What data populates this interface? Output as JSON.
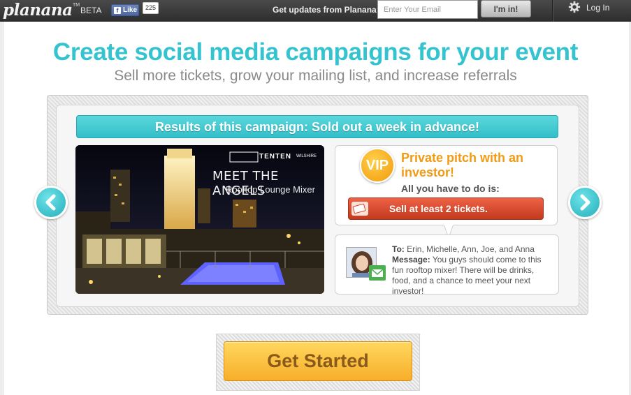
{
  "topbar": {
    "logo": "planana",
    "logo_tm": "TM",
    "beta": "BETA",
    "fb_like_label": "Like",
    "fb_like_count": "225",
    "updates_label": "Get updates from Planana:",
    "email_placeholder": "Enter Your Email",
    "submit_label": "I'm in!",
    "login_label": "Log In"
  },
  "hero": {
    "headline": "Create social media campaigns for your event",
    "subheadline": "Sell more tickets, grow your mailing list, and increase referrals"
  },
  "showcase": {
    "banner": "Results of this campaign: Sold out a week in advance!",
    "event_image": {
      "title": "MEET THE ANGELS",
      "subtitle": "Rooftop Lounge Mixer",
      "logo_text": "TENTEN",
      "logo_sub": "WILSHIRE"
    },
    "vip": {
      "badge": "VIP",
      "title": "Private pitch with an investor!",
      "subtitle": "All you have to do is:",
      "button_label": "Sell at least 2 tickets."
    },
    "message": {
      "to_label": "To:",
      "to_value": "Erin, Michelle, Ann, Joe, and Anna",
      "message_label": "Message:",
      "message_value": "You guys should come to this fun rooftop mixer! There will be drinks, food, and a chance to meet your next investor!"
    }
  },
  "cta": {
    "label": "Get Started"
  },
  "colors": {
    "topbar": "#3a3a3a",
    "teal_accent": "#35c4cf",
    "orange_accent": "#f29a12",
    "red_button": "#d9482b",
    "cta_yellow": "#f9c23c"
  },
  "icons": [
    "facebook-icon",
    "gear-icon",
    "chevron-left-icon",
    "chevron-right-icon",
    "ticket-icon",
    "mail-icon"
  ]
}
